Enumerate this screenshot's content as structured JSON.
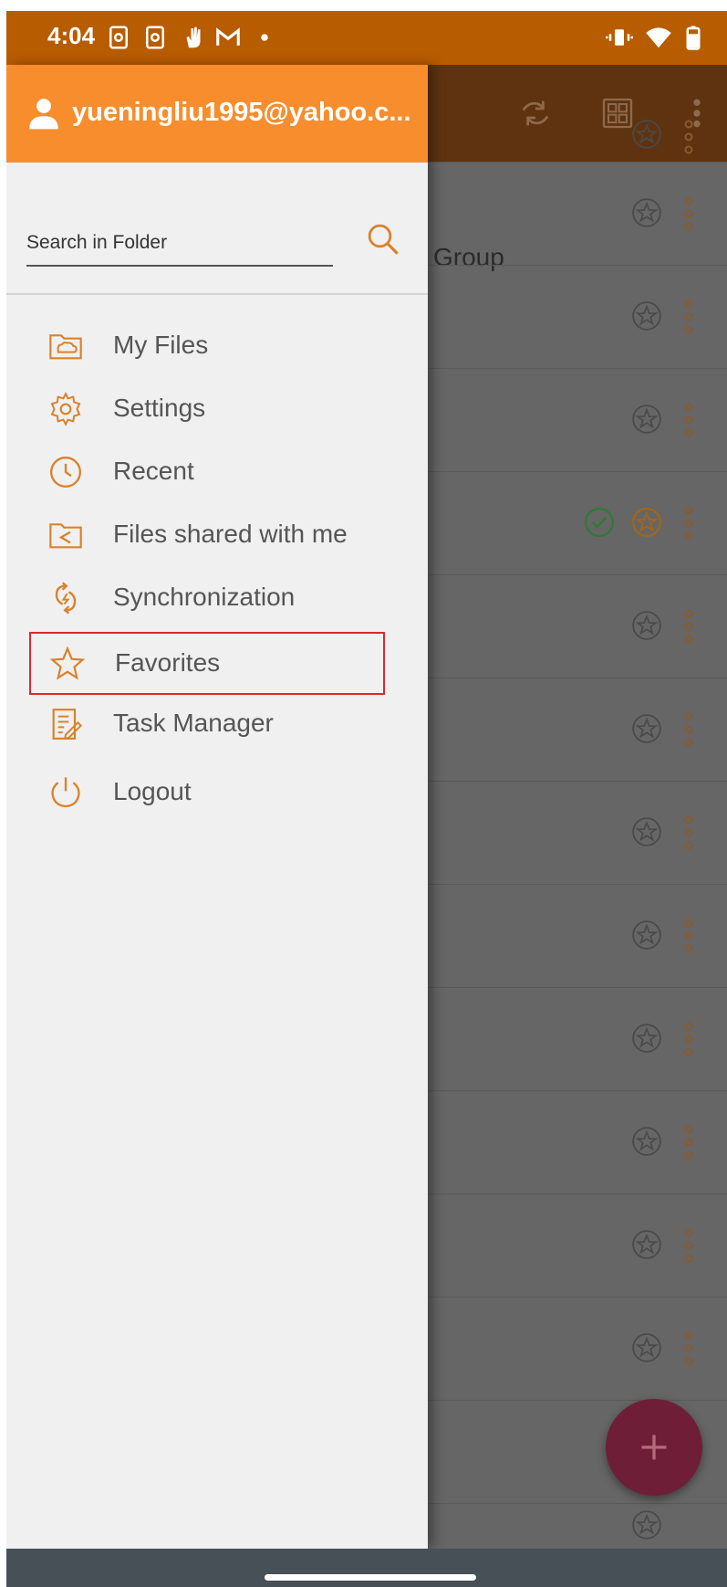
{
  "status_bar": {
    "time": "4:04",
    "left_icons": [
      "screenshot-icon",
      "screenshot-icon",
      "hand-icon",
      "gmail-icon",
      "dot-icon"
    ],
    "right_icons": [
      "vibrate-icon",
      "wifi-icon",
      "battery-icon"
    ]
  },
  "drawer": {
    "user_email": "yueningliu1995@yahoo.c...",
    "search_placeholder": "Search in Folder",
    "items": [
      {
        "label": "My Files",
        "icon": "cloud-folder-icon"
      },
      {
        "label": "Settings",
        "icon": "gear-icon"
      },
      {
        "label": "Recent",
        "icon": "clock-icon"
      },
      {
        "label": "Files shared with me",
        "icon": "shared-folder-icon"
      },
      {
        "label": "Synchronization",
        "icon": "sync-icon"
      },
      {
        "label": "Favorites",
        "icon": "star-icon",
        "highlighted": true
      },
      {
        "label": "Task Manager",
        "icon": "task-list-icon"
      },
      {
        "label": "Logout",
        "icon": "power-icon"
      }
    ]
  },
  "background": {
    "partial_text": "Group",
    "toolbar_icons": [
      "sync-icon",
      "grid-view-icon",
      "more-vert-icon"
    ]
  },
  "fab": {
    "icon": "plus-icon"
  },
  "colors": {
    "status_bar": "#b85c00",
    "drawer_header": "#f78d2d",
    "accent": "#d9822b",
    "highlight_border": "#e0262e",
    "fab": "#6e1f37"
  }
}
